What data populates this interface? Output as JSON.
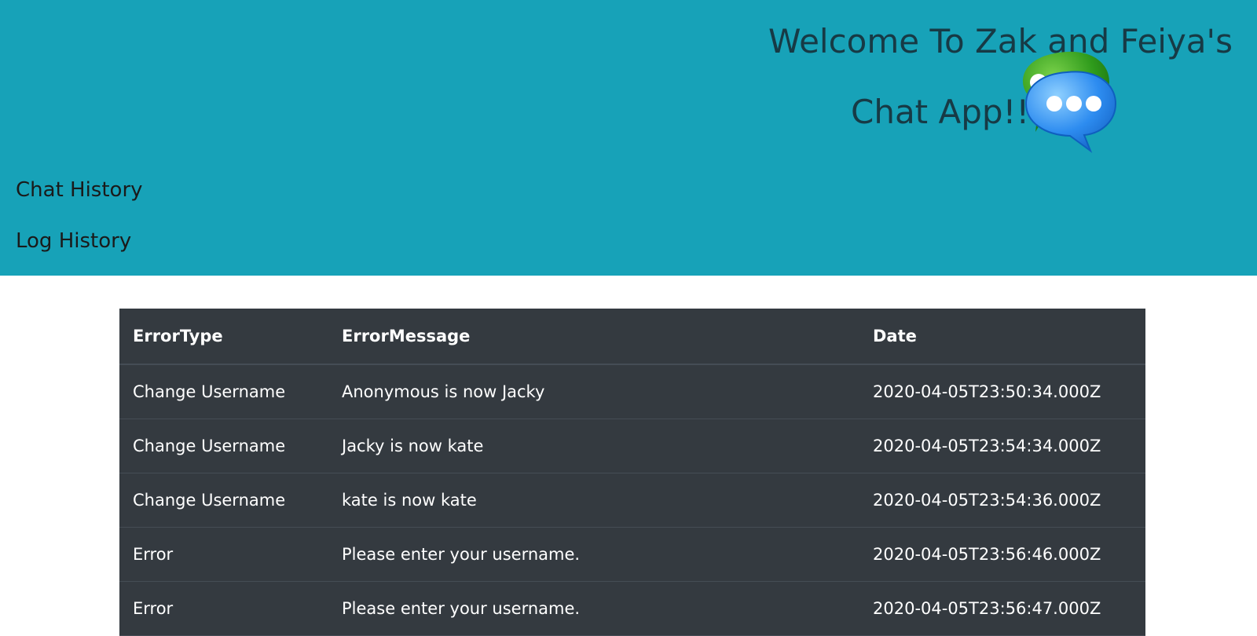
{
  "header": {
    "title_line1": "Welcome To Zak and Feiya's",
    "title_line2": "Chat App!!",
    "logo_icon": "chat-bubbles-icon",
    "background_color": "#17a2b8",
    "title_color": "#173a45"
  },
  "nav": {
    "chat_history": "Chat History",
    "log_history": "Log History"
  },
  "table": {
    "background_color": "#343a40",
    "columns": [
      "ErrorType",
      "ErrorMessage",
      "Date"
    ],
    "rows": [
      [
        "Change Username",
        "Anonymous is now Jacky",
        "2020-04-05T23:50:34.000Z"
      ],
      [
        "Change Username",
        "Jacky is now kate",
        "2020-04-05T23:54:34.000Z"
      ],
      [
        "Change Username",
        "kate is now kate",
        "2020-04-05T23:54:36.000Z"
      ],
      [
        "Error",
        "Please enter your username.",
        "2020-04-05T23:56:46.000Z"
      ],
      [
        "Error",
        "Please enter your username.",
        "2020-04-05T23:56:47.000Z"
      ]
    ]
  }
}
